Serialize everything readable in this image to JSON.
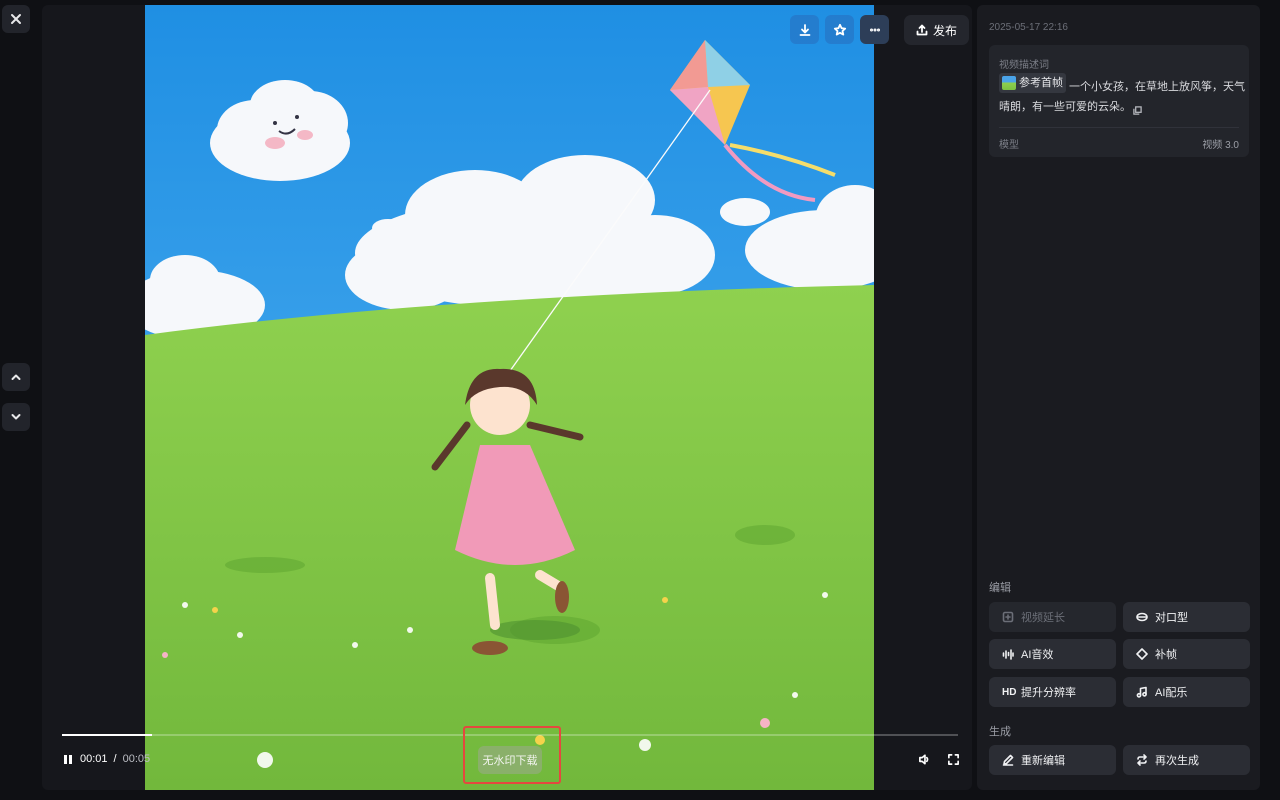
{
  "player": {
    "current_time": "00:01",
    "separator": "/",
    "total_time": "00:05",
    "progress": 0.1,
    "download_no_watermark": "无水印下载",
    "publish_label": "发布"
  },
  "details": {
    "timestamp": "2025-05-17 22:16",
    "description_label": "视频描述词",
    "reference_chip": "参考首帧",
    "description_text": "一个小女孩，在草地上放风筝，天气晴朗，有一些可爱的云朵。",
    "model_label": "模型",
    "model_value": "视频 3.0"
  },
  "edit": {
    "section_title": "编辑",
    "extend": "视频延长",
    "lip_sync": "对口型",
    "ai_sfx": "AI音效",
    "frame_interp": "补帧",
    "upscale_badge": "HD",
    "upscale": "提升分辨率",
    "ai_music": "AI配乐"
  },
  "generate": {
    "section_title": "生成",
    "re_edit": "重新编辑",
    "regenerate": "再次生成"
  },
  "icons": [
    "close-icon",
    "chevron-up-icon",
    "chevron-down-icon",
    "download-icon",
    "star-icon",
    "more-icon",
    "upload-icon",
    "pause-icon",
    "volume-icon",
    "fullscreen-icon",
    "copy-icon",
    "pencil-icon",
    "repeat-icon"
  ],
  "colors": {
    "highlight_box": "#e5483f",
    "sky": "#2d9be8",
    "grass": "#7cc142"
  }
}
